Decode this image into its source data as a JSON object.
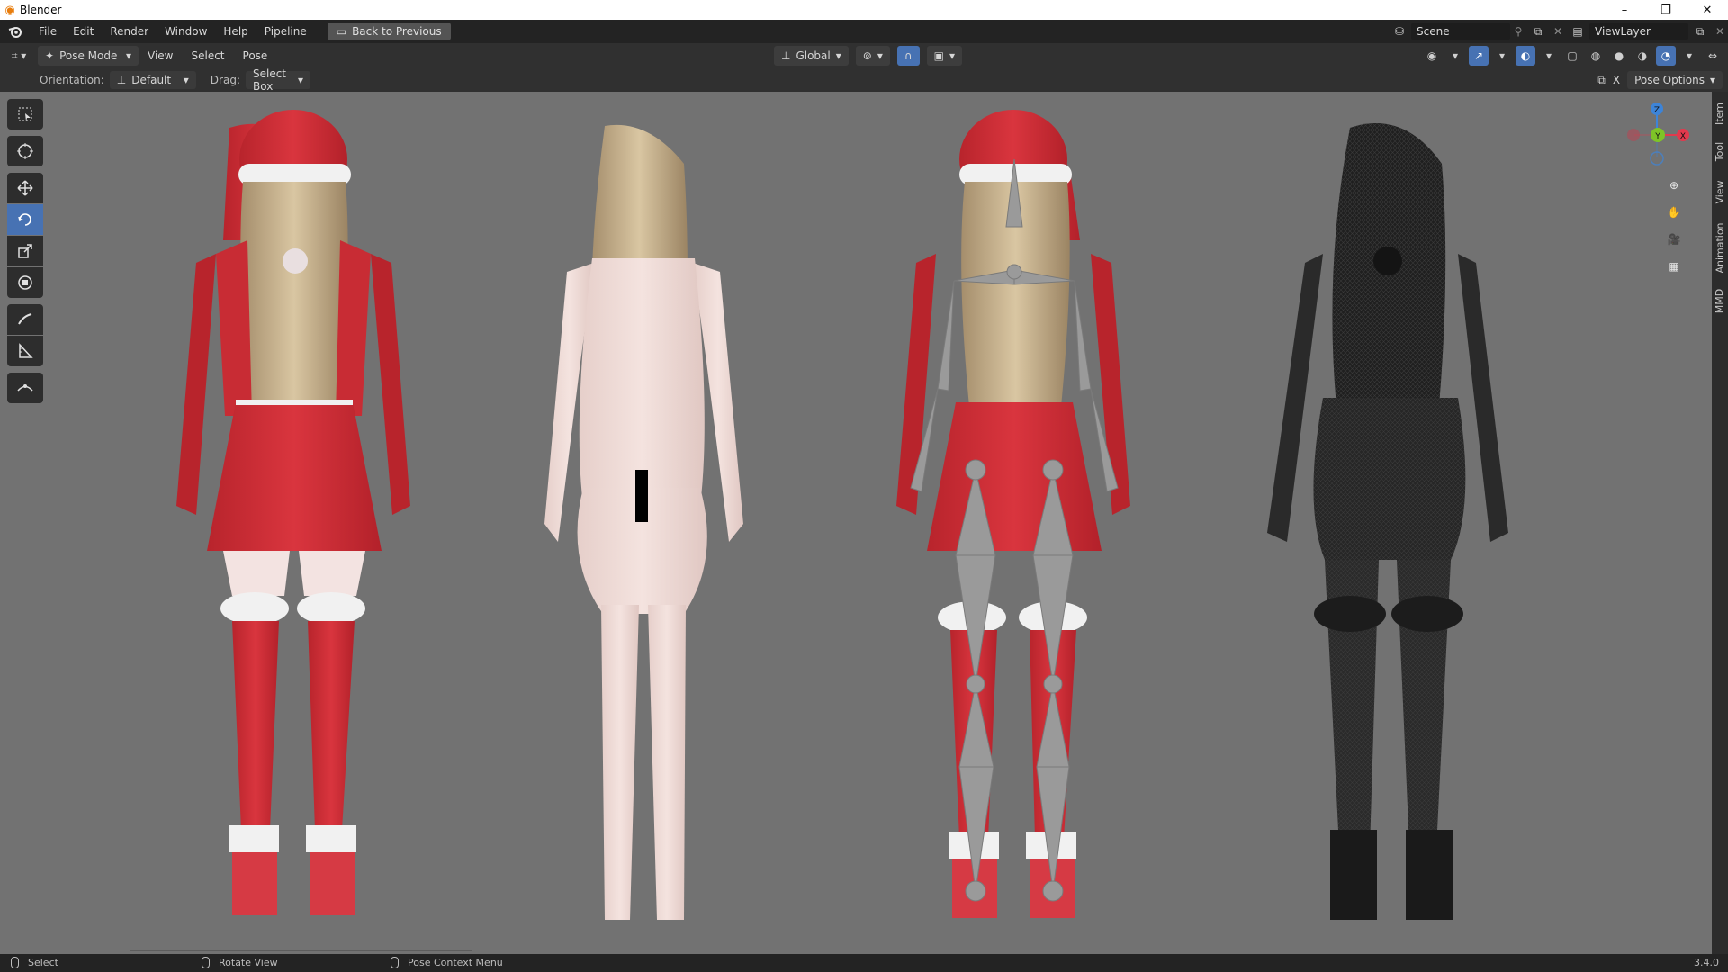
{
  "window": {
    "title": "Blender",
    "controls": [
      "–",
      "❐",
      "✕"
    ]
  },
  "menubar": {
    "items": [
      "File",
      "Edit",
      "Render",
      "Window",
      "Help",
      "Pipeline"
    ],
    "back_button": "Back to Previous",
    "scene": "Scene",
    "view_layer": "ViewLayer"
  },
  "viewport_header": {
    "mode": "Pose Mode",
    "menus": [
      "View",
      "Select",
      "Pose"
    ],
    "transform_orientation": "Global"
  },
  "tool_settings": {
    "orientation_label": "Orientation:",
    "orientation_value": "Default",
    "drag_label": "Drag:",
    "drag_value": "Select Box",
    "pose_options": "Pose Options",
    "x_label": "X"
  },
  "sidebar_tabs": [
    "Item",
    "Tool",
    "View",
    "Animation",
    "MMD"
  ],
  "gizmo": {
    "z": "Z",
    "y": "Y",
    "x": "X"
  },
  "statusbar": {
    "left": "Select",
    "middle": "Rotate View",
    "right": "Pose Context Menu",
    "version": "3.4.0"
  },
  "colors": {
    "viewport_bg": "#727272",
    "accent": "#4772b3",
    "x_axis": "#e2394d",
    "y_axis": "#7ec427",
    "z_axis": "#3d84d8"
  }
}
